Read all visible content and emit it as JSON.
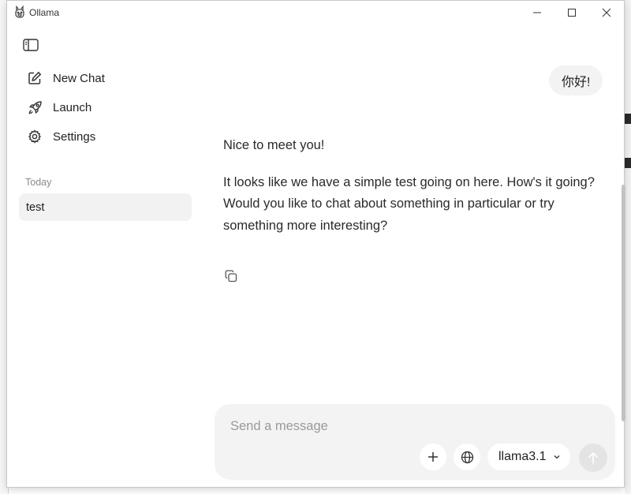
{
  "window": {
    "title": "Ollama"
  },
  "sidebar": {
    "items": [
      {
        "label": "New Chat",
        "icon": "compose-icon"
      },
      {
        "label": "Launch",
        "icon": "rocket-icon"
      },
      {
        "label": "Settings",
        "icon": "gear-icon"
      }
    ],
    "section_today": "Today",
    "chats": [
      {
        "label": "test"
      }
    ]
  },
  "conversation": {
    "user_message": "你好!",
    "assistant_paragraphs": [
      "Nice to meet you!",
      "It looks like we have a simple test going on here. How's it going? Would you like to chat about something in particular or try something more interesting?"
    ]
  },
  "composer": {
    "placeholder": "Send a message",
    "model": "llama3.1"
  },
  "colors": {
    "composer_bg": "#f3f3f3",
    "selected_chat_bg": "#f2f2f2",
    "send_disabled_bg": "#e4e4e4"
  }
}
